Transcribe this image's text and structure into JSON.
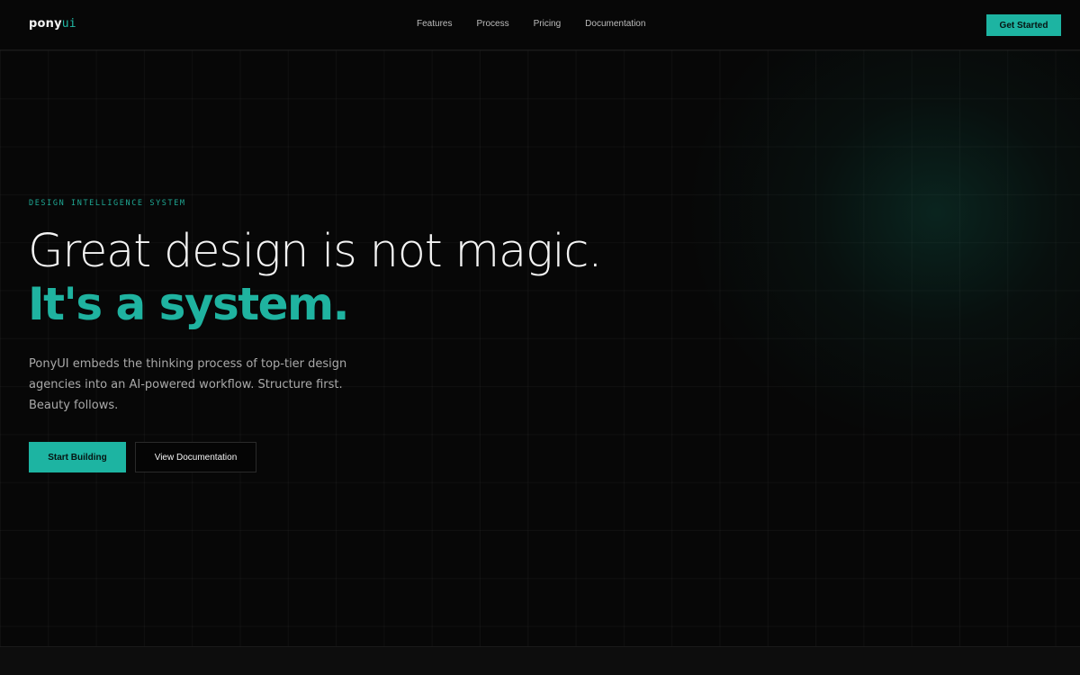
{
  "nav": {
    "logo_main": "pony",
    "logo_accent": "ui",
    "links": [
      "Features",
      "Process",
      "Pricing",
      "Documentation"
    ],
    "cta_label": "Get Started"
  },
  "hero": {
    "eyebrow": "DESIGN INTELLIGENCE SYSTEM",
    "headline_line1": "Great design is not magic.",
    "headline_line2": "It's a system.",
    "lede": "PonyUI embeds the thinking process of top-tier design agencies into an AI-powered workflow. Structure first. Beauty follows.",
    "primary_label": "Start Building",
    "secondary_label": "View Documentation"
  },
  "colors": {
    "accent": "#1db4a2",
    "background": "#070707",
    "text": "#f4f4f4",
    "muted": "#a9a9a9"
  }
}
